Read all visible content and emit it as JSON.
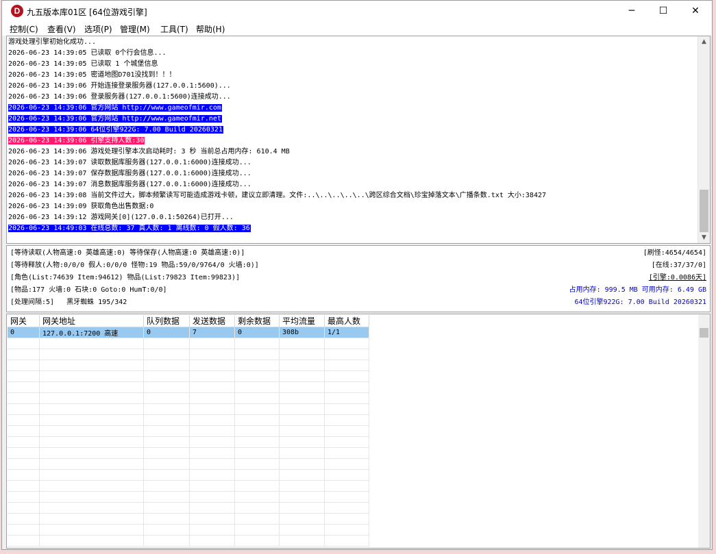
{
  "window": {
    "title": "九五版本库01区 [64位游戏引擎]",
    "icon_letter": "D",
    "minimize": "─",
    "maximize": "☐",
    "close": "✕"
  },
  "menu": [
    "控制(C)",
    "查看(V)",
    "选项(P)",
    "管理(M)",
    "工具(T)",
    "帮助(H)"
  ],
  "log": [
    {
      "text": "游戏处理引擎初始化成功...",
      "hl": ""
    },
    {
      "text": "2026-06-23 14:39:05 已读取 0个行会信息...",
      "hl": ""
    },
    {
      "text": "2026-06-23 14:39:05 已读取 1 个城堡信息",
      "hl": ""
    },
    {
      "text": "2026-06-23 14:39:05 密道地图D701没找到！！！",
      "hl": ""
    },
    {
      "text": "2026-06-23 14:39:06 开始连接登录服务器(127.0.0.1:5600)...",
      "hl": ""
    },
    {
      "text": "2026-06-23 14:39:06 登录服务器(127.0.0.1:5600)连接成功...",
      "hl": ""
    },
    {
      "text": "2026-06-23 14:39:06 官方网站 http://www.gameofmir.com",
      "hl": "blue"
    },
    {
      "text": "2026-06-23 14:39:06 官方网站 http://www.gameofmir.net",
      "hl": "blue"
    },
    {
      "text": "2026-06-23 14:39:06 64位引擎922G: 7.00 Build 20260321",
      "hl": "blue"
    },
    {
      "text": "2026-06-23 14:39:06 引擎支持人数:30",
      "hl": "pink"
    },
    {
      "text": "2026-06-23 14:39:06 游戏处理引擎本次启动耗时: 3 秒 当前总占用内存: 610.4 MB",
      "hl": ""
    },
    {
      "text": "2026-06-23 14:39:07 读取数据库服务器(127.0.0.1:6000)连接成功...",
      "hl": ""
    },
    {
      "text": "2026-06-23 14:39:07 保存数据库服务器(127.0.0.1:6000)连接成功...",
      "hl": ""
    },
    {
      "text": "2026-06-23 14:39:07 消息数据库服务器(127.0.0.1:6000)连接成功...",
      "hl": ""
    },
    {
      "text": "2026-06-23 14:39:08 当前文件过大，脚本频繁读写可能造成游戏卡顿，建议立即清理。文件:..\\..\\..\\..\\..\\跨区综合文档\\珍宝掉落文本\\广播条数.txt 大小:38427",
      "hl": ""
    },
    {
      "text": "2026-06-23 14:39:09 获取角色出售数据:0",
      "hl": ""
    },
    {
      "text": "2026-06-23 14:39:12 游戏网关[0](127.0.0.1:50264)已打开...",
      "hl": ""
    },
    {
      "text": "2026-06-23 14:49:03 在线总数: 37 真人数: 1 离线数: 0 假人数: 36",
      "hl": "blue"
    }
  ],
  "status": {
    "left": [
      "[等待读取(人物高速:0 英雄高速:0) 等待保存(人物高速:0 英雄高速:0)]",
      "[等待释放(人物:0/0/0 假人:0/0/0 怪物:19 物品:59/0/9764/0 火墙:0)]",
      "[角色(List:74639 Item:94612) 物品(List:79823 Item:99823)]",
      "[物品:177 火墙:0 石块:0 Goto:0 HumT:0/0]",
      "[处理间隔:5]   黑牙蜘蛛 195/342"
    ],
    "right": [
      "[刷怪:4654/4654]",
      "[在线:37/37/0]",
      "[引擎:0.0086天]",
      "占用内存: 999.5 MB 可用内存: 6.49 GB",
      "64位引擎922G: 7.00 Build 20260321"
    ]
  },
  "table": {
    "headers": [
      "网关",
      "网关地址",
      "队列数据",
      "发送数据",
      "剩余数据",
      "平均流量",
      "最高人数"
    ],
    "rows": [
      [
        "0",
        "127.0.0.1:7200 高速",
        "0",
        "7",
        "0",
        "308b",
        "1/1"
      ]
    ],
    "empty_rows": 19
  },
  "colors": {
    "highlight_blue": "#0000ff",
    "highlight_pink": "#ff1a6d",
    "selected_row": "#99c9ef",
    "info_blue": "#0000cc"
  }
}
